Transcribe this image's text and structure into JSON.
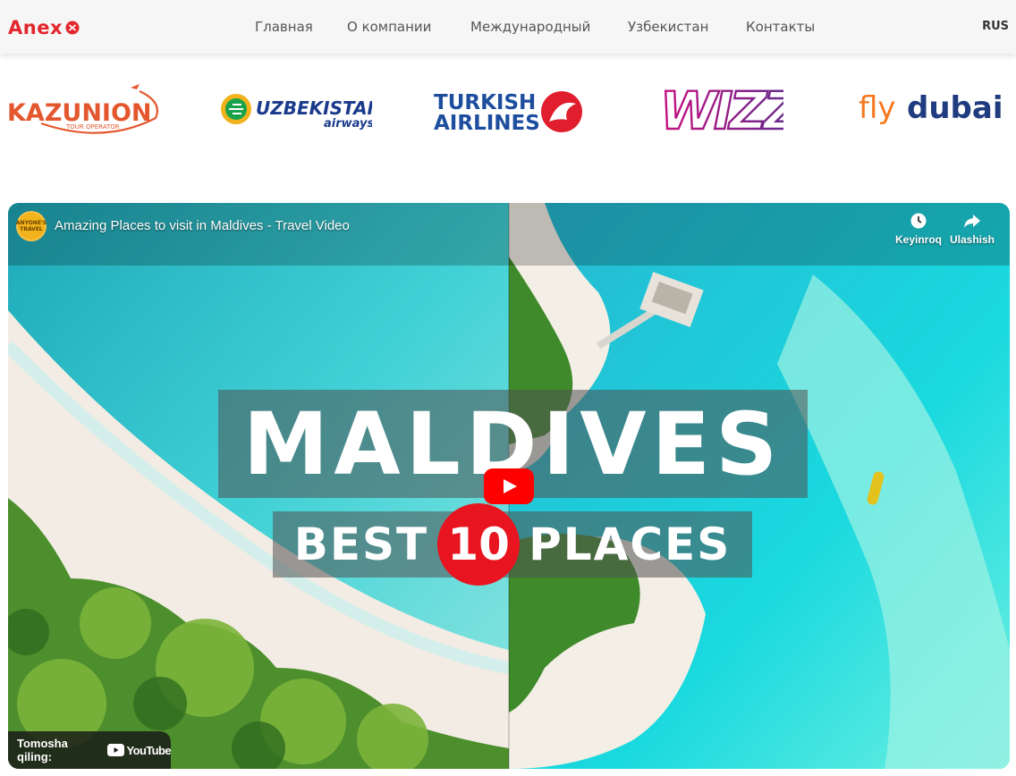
{
  "header": {
    "logo_text": "Anex",
    "nav": [
      "Главная",
      "О компании",
      "Международный",
      "Узбекистан",
      "Контакты"
    ],
    "language": "RUS"
  },
  "partners": [
    {
      "name": "KAZUNION",
      "tagline": "TOUR OPERATOR"
    },
    {
      "name": "UZBEKISTAN",
      "tagline": "airways"
    },
    {
      "name": "TURKISH",
      "tagline": "AIRLINES"
    },
    {
      "name": "WIZZ",
      "tagline": ""
    },
    {
      "name_a": "fly",
      "name_b": "dubai"
    }
  ],
  "video": {
    "channel_badge": "ANYONE'S TRAVEL",
    "title": "Amazing Places to visit in Maldives - Travel Video",
    "watch_later": "Keyinroq",
    "share": "Ulashish",
    "watch_on": "Tomosha qiling:",
    "youtube": "YouTube",
    "overlay_title": "MALDIVES",
    "overlay_sub_left": "BEST",
    "overlay_number": "10",
    "overlay_sub_right": "PLACES"
  },
  "colors": {
    "brand_red": "#e3262c",
    "kazunion_orange": "#e4572e",
    "uzbek_blue": "#1a3a8c",
    "turkish_blue": "#1d4e9e",
    "turkish_red": "#e01e2d",
    "wizz_purple": "#c6117f",
    "flydubai_orange": "#f47920",
    "flydubai_blue": "#1f3c80"
  }
}
